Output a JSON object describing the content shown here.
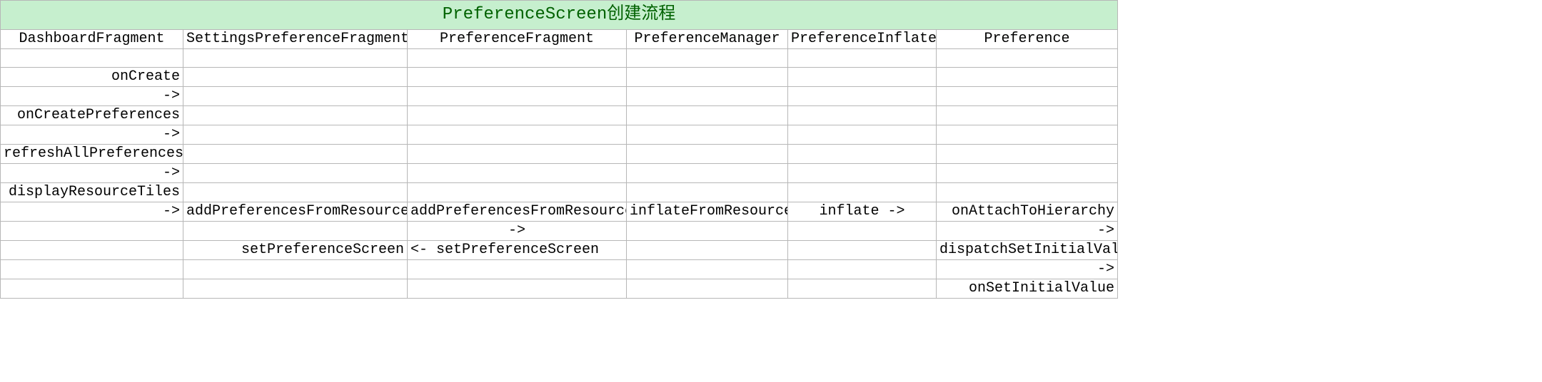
{
  "title": "PreferenceScreen创建流程",
  "columns": {
    "a": "DashboardFragment",
    "b": "SettingsPreferenceFragment",
    "c": "PreferenceFragment",
    "d": "PreferenceManager",
    "e": "PreferenceInflater",
    "f": "Preference"
  },
  "rows": [
    {
      "a": "",
      "b": "",
      "c": "",
      "d": "",
      "e": "",
      "f": ""
    },
    {
      "a": "onCreate",
      "b": "",
      "c": "",
      "d": "",
      "e": "",
      "f": ""
    },
    {
      "a": "->",
      "b": "",
      "c": "",
      "d": "",
      "e": "",
      "f": ""
    },
    {
      "a": "onCreatePreferences",
      "b": "",
      "c": "",
      "d": "",
      "e": "",
      "f": ""
    },
    {
      "a": "->",
      "b": "",
      "c": "",
      "d": "",
      "e": "",
      "f": ""
    },
    {
      "a": "refreshAllPreferences",
      "b": "",
      "c": "",
      "d": "",
      "e": "",
      "f": ""
    },
    {
      "a": "->",
      "b": "",
      "c": "",
      "d": "",
      "e": "",
      "f": ""
    },
    {
      "a": "displayResourceTiles",
      "b": "",
      "c": "",
      "d": "",
      "e": "",
      "f": ""
    },
    {
      "a": "->",
      "b": "addPreferencesFromResource ->",
      "c": "addPreferencesFromResource ->",
      "d": "inflateFromResource ->",
      "e": "inflate ->",
      "f": "onAttachToHierarchy"
    },
    {
      "a": "",
      "b": "",
      "c": "->",
      "d": "",
      "e": "",
      "f": "->"
    },
    {
      "a": "",
      "b": "setPreferenceScreen",
      "c": "<- setPreferenceScreen",
      "d": "",
      "e": "",
      "f": "dispatchSetInitialValue"
    },
    {
      "a": "",
      "b": "",
      "c": "",
      "d": "",
      "e": "",
      "f": "->"
    },
    {
      "a": "",
      "b": "",
      "c": "",
      "d": "",
      "e": "",
      "f": "onSetInitialValue"
    }
  ],
  "chart_data": {
    "type": "table",
    "title": "PreferenceScreen创建流程",
    "columns": [
      "DashboardFragment",
      "SettingsPreferenceFragment",
      "PreferenceFragment",
      "PreferenceManager",
      "PreferenceInflater",
      "Preference"
    ],
    "rows": [
      [
        "",
        "",
        "",
        "",
        "",
        ""
      ],
      [
        "onCreate",
        "",
        "",
        "",
        "",
        ""
      ],
      [
        "->",
        "",
        "",
        "",
        "",
        ""
      ],
      [
        "onCreatePreferences",
        "",
        "",
        "",
        "",
        ""
      ],
      [
        "->",
        "",
        "",
        "",
        "",
        ""
      ],
      [
        "refreshAllPreferences",
        "",
        "",
        "",
        "",
        ""
      ],
      [
        "->",
        "",
        "",
        "",
        "",
        ""
      ],
      [
        "displayResourceTiles",
        "",
        "",
        "",
        "",
        ""
      ],
      [
        "->",
        "addPreferencesFromResource ->",
        "addPreferencesFromResource ->",
        "inflateFromResource ->",
        "inflate ->",
        "onAttachToHierarchy"
      ],
      [
        "",
        "",
        "->",
        "",
        "",
        "->"
      ],
      [
        "",
        "setPreferenceScreen",
        "<- setPreferenceScreen",
        "",
        "",
        "dispatchSetInitialValue"
      ],
      [
        "",
        "",
        "",
        "",
        "",
        "->"
      ],
      [
        "",
        "",
        "",
        "",
        "",
        "onSetInitialValue"
      ]
    ]
  }
}
